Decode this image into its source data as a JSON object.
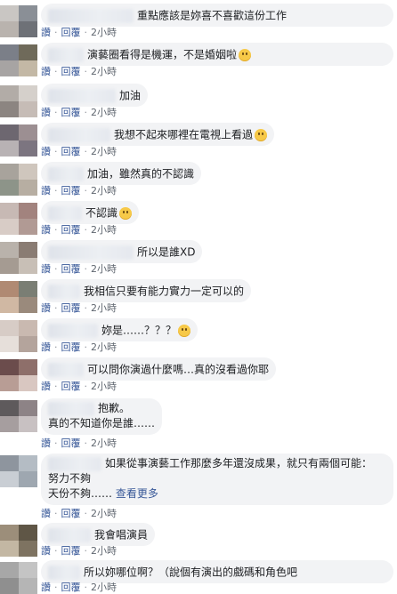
{
  "actions": {
    "like": "讚",
    "reply": "回覆",
    "separator": "·"
  },
  "comments": [
    {
      "text": "重點應該是妳喜不喜歡這份工作",
      "time": "2小時",
      "emoji": ""
    },
    {
      "text": "演藝圈看得是機運，不是婚姻啦",
      "time": "2小時",
      "emoji": "grinning-face"
    },
    {
      "text": "加油",
      "time": "2小時",
      "emoji": ""
    },
    {
      "text": "我想不起來哪裡在電視上看過",
      "time": "2小時",
      "emoji": "sad-face"
    },
    {
      "text": "加油，雖然真的不認識",
      "time": "2小時",
      "emoji": ""
    },
    {
      "text": "不認識",
      "time": "2小時",
      "emoji": "dizzy-face"
    },
    {
      "text": "所以是誰XD",
      "time": "2小時",
      "emoji": ""
    },
    {
      "text": "我相信只要有能力實力一定可以的",
      "time": "2小時",
      "emoji": ""
    },
    {
      "text": "妳是……？？？",
      "time": "2小時",
      "emoji": "flushed-face"
    },
    {
      "text": "可以問你演過什麼嗎…真的沒看過你耶",
      "time": "2小時",
      "emoji": ""
    },
    {
      "text": "抱歉。",
      "line2": "真的不知道你是誰……",
      "time": "2小時",
      "emoji": ""
    },
    {
      "text": "如果從事演藝工作那麼多年還沒成果，就只有兩個可能：",
      "line2": "努力不夠",
      "line3": "天份不夠……",
      "see_more": "查看更多",
      "time": "2小時",
      "emoji": ""
    },
    {
      "text": "我會唱演員",
      "time": "2小時",
      "emoji": ""
    },
    {
      "text": "所以妳哪位啊？（說個有演出的戲碼和角色吧",
      "time": "2小時",
      "emoji": ""
    }
  ]
}
